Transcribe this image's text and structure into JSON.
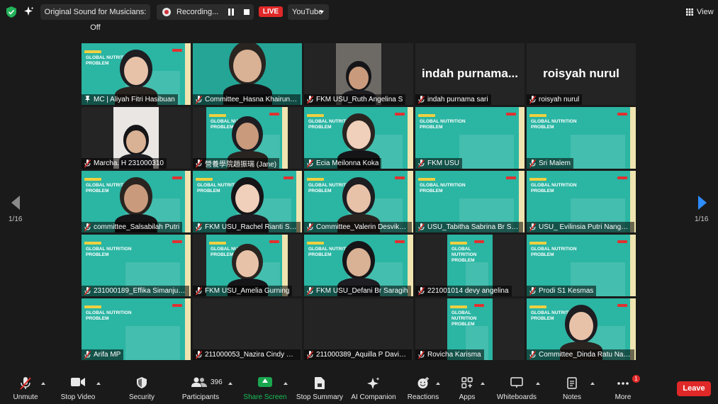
{
  "topbar": {
    "sound_toggle": "Original Sound for Musicians: Off",
    "recording_label": "Recording...",
    "live_badge": "LIVE",
    "stream_target": "YouTube",
    "view_label": "View"
  },
  "gallery": {
    "page_indicator_left": "1/16",
    "page_indicator_right": "1/16",
    "tiles": [
      {
        "name": "MC | Aliyah Fitri Hasibuan",
        "type": "slide-person",
        "active": true,
        "muted": false
      },
      {
        "name": "Committee_Hasna Khairunni...",
        "type": "person",
        "muted": true
      },
      {
        "name": "FKM USU_Ruth Angelina S",
        "type": "small-video",
        "muted": true
      },
      {
        "name": "indah purnama sari",
        "type": "text",
        "display_name": "indah  purnama...",
        "muted": true
      },
      {
        "name": "roisyah nurul",
        "type": "text",
        "display_name": "roisyah nurul",
        "muted": true
      },
      {
        "name": "Marcha. H 231000310",
        "type": "small-video",
        "muted": true
      },
      {
        "name": "營養學院趙振瑞 (Jane)",
        "type": "slide-person-narrow",
        "muted": true
      },
      {
        "name": "Ecia Meilonna Koka",
        "type": "slide-person",
        "muted": true
      },
      {
        "name": "FKM USU",
        "type": "slide",
        "muted": true
      },
      {
        "name": "Sri Malem",
        "type": "slide",
        "muted": true
      },
      {
        "name": "committee_Salsabilah Putri",
        "type": "slide-person",
        "muted": true
      },
      {
        "name": "FKM USU_Rachel Rianti Silit...",
        "type": "slide-person",
        "muted": true
      },
      {
        "name": "Committee_Valerin Desvika ...",
        "type": "slide-person",
        "muted": true
      },
      {
        "name": "USU_Tabitha Sabrina Br Sur...",
        "type": "slide",
        "muted": true
      },
      {
        "name": "USU_ Evilinsia Putri Nangkok",
        "type": "slide",
        "muted": true
      },
      {
        "name": "231000189_Effika Simanjunt...",
        "type": "slide",
        "muted": true
      },
      {
        "name": "FKM USU_Amelia Gurning",
        "type": "slide-person-narrow",
        "muted": true
      },
      {
        "name": "FKM USU_Defani Br Saragih",
        "type": "slide-person",
        "muted": true
      },
      {
        "name": "221001014 devy angelina",
        "type": "slide-narrow",
        "muted": true
      },
      {
        "name": "Prodi S1 Kesmas",
        "type": "slide",
        "muted": true
      },
      {
        "name": "Arifa MP",
        "type": "slide",
        "muted": true
      },
      {
        "name": "211000053_Nazira Cindy Sya...",
        "type": "dark",
        "muted": true
      },
      {
        "name": "211000389_Aquilla P Davina...",
        "type": "dark",
        "muted": true
      },
      {
        "name": "Rovicha Karisma",
        "type": "slide-narrow",
        "muted": true
      },
      {
        "name": "Committee_Dinda Ratu Nayla",
        "type": "slide-person",
        "muted": true
      }
    ],
    "slide_title_line1": "GLOBAL NUTRITION",
    "slide_title_line2": "PROBLEM"
  },
  "toolbar": {
    "unmute": "Unmute",
    "stop_video": "Stop Video",
    "security": "Security",
    "participants": "Participants",
    "participants_count": "396",
    "share_screen": "Share Screen",
    "stop_summary": "Stop Summary",
    "ai_companion": "AI Companion",
    "reactions": "Reactions",
    "apps": "Apps",
    "whiteboards": "Whiteboards",
    "notes": "Notes",
    "more": "More",
    "more_badge": "1",
    "leave": "Leave"
  },
  "colors": {
    "background": "#1a1a1a",
    "slide_teal": "#2bb5a3",
    "live_red": "#e02828",
    "share_green": "#19a64f",
    "active_speaker": "#d3d84a",
    "nav_blue": "#2d8cff"
  }
}
